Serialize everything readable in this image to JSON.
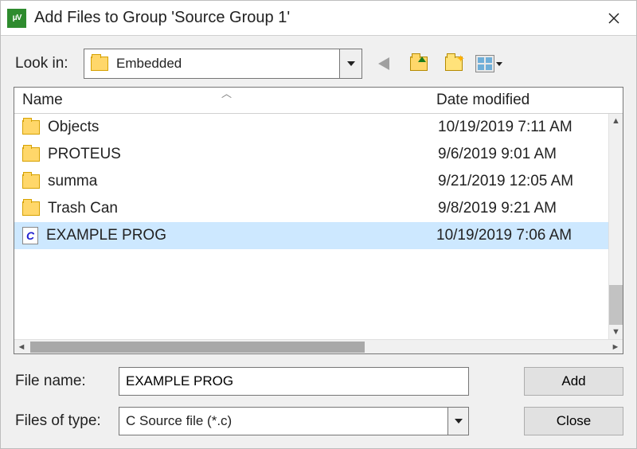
{
  "window": {
    "title": "Add Files to Group 'Source Group 1'"
  },
  "lookin": {
    "label": "Look in:",
    "current": "Embedded"
  },
  "columns": {
    "name": "Name",
    "date": "Date modified"
  },
  "files": [
    {
      "icon": "folder",
      "name": "Objects",
      "date": "10/19/2019 7:11 AM",
      "selected": false
    },
    {
      "icon": "folder",
      "name": "PROTEUS",
      "date": "9/6/2019 9:01 AM",
      "selected": false
    },
    {
      "icon": "folder",
      "name": "summa",
      "date": "9/21/2019 12:05 AM",
      "selected": false
    },
    {
      "icon": "folder",
      "name": "Trash Can",
      "date": "9/8/2019 9:21 AM",
      "selected": false
    },
    {
      "icon": "cfile",
      "name": "EXAMPLE PROG",
      "date": "10/19/2019 7:06 AM",
      "selected": true
    }
  ],
  "form": {
    "filename_label": "File name:",
    "filename_value": "EXAMPLE PROG",
    "type_label": "Files of type:",
    "type_value": "C Source file (*.c)"
  },
  "buttons": {
    "add": "Add",
    "close": "Close"
  }
}
